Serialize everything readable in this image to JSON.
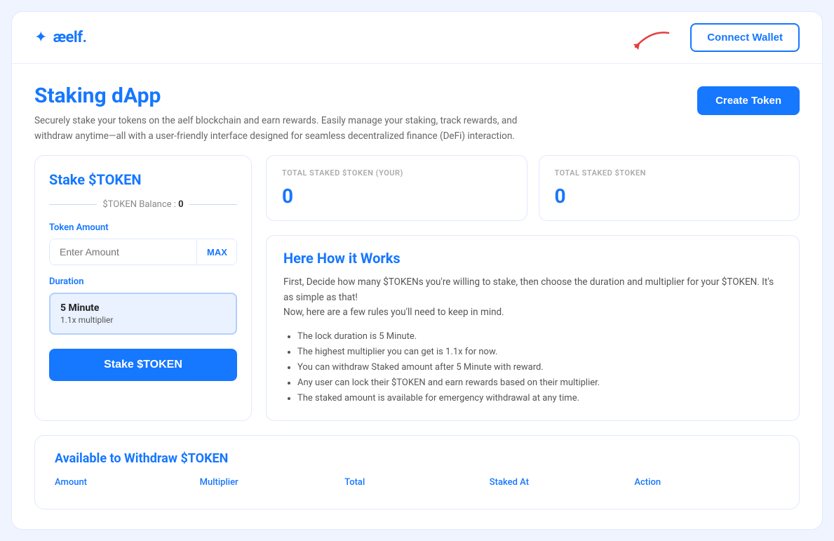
{
  "header": {
    "logo_icon": "✦",
    "logo_text": "æelf.",
    "connect_wallet_label": "Connect Wallet"
  },
  "page": {
    "title": "Staking dApp",
    "description": "Securely stake your tokens on the aelf blockchain and earn rewards. Easily manage your staking, track rewards, and withdraw anytime—all with a user-friendly interface designed for seamless decentralized finance (DeFi) interaction.",
    "create_token_label": "Create Token"
  },
  "stake_card": {
    "title": "Stake $TOKEN",
    "balance_label": "$TOKEN Balance :",
    "balance_value": "0",
    "token_amount_label": "Token Amount",
    "amount_placeholder": "Enter Amount",
    "max_label": "MAX",
    "duration_label": "Duration",
    "duration_option_title": "5 Minute",
    "duration_option_sub": "1.1x multiplier",
    "stake_btn_label": "Stake $TOKEN"
  },
  "stats": {
    "your_staked_label": "TOTAL STAKED $TOKEN (YOUR)",
    "your_staked_value": "0",
    "total_staked_label": "TOTAL STAKED $TOKEN",
    "total_staked_value": "0"
  },
  "how_it_works": {
    "title": "Here How it Works",
    "intro_line1": "First, Decide how many $TOKENs you're willing to stake, then choose the duration and multiplier for your $TOKEN. It's as simple as that!",
    "intro_line2": "Now, here are a few rules you'll need to keep in mind.",
    "rules": [
      "The lock duration is 5 Minute.",
      "The highest multiplier you can get is 1.1x for now.",
      "You can withdraw Staked amount after 5 Minute with reward.",
      "Any user can lock their $TOKEN and earn rewards based on their multiplier.",
      "The staked amount is available for emergency withdrawal at any time."
    ]
  },
  "withdraw_section": {
    "title": "Available to Withdraw $TOKEN",
    "columns": [
      "Amount",
      "Multiplier",
      "Total",
      "Staked At",
      "Action"
    ]
  }
}
